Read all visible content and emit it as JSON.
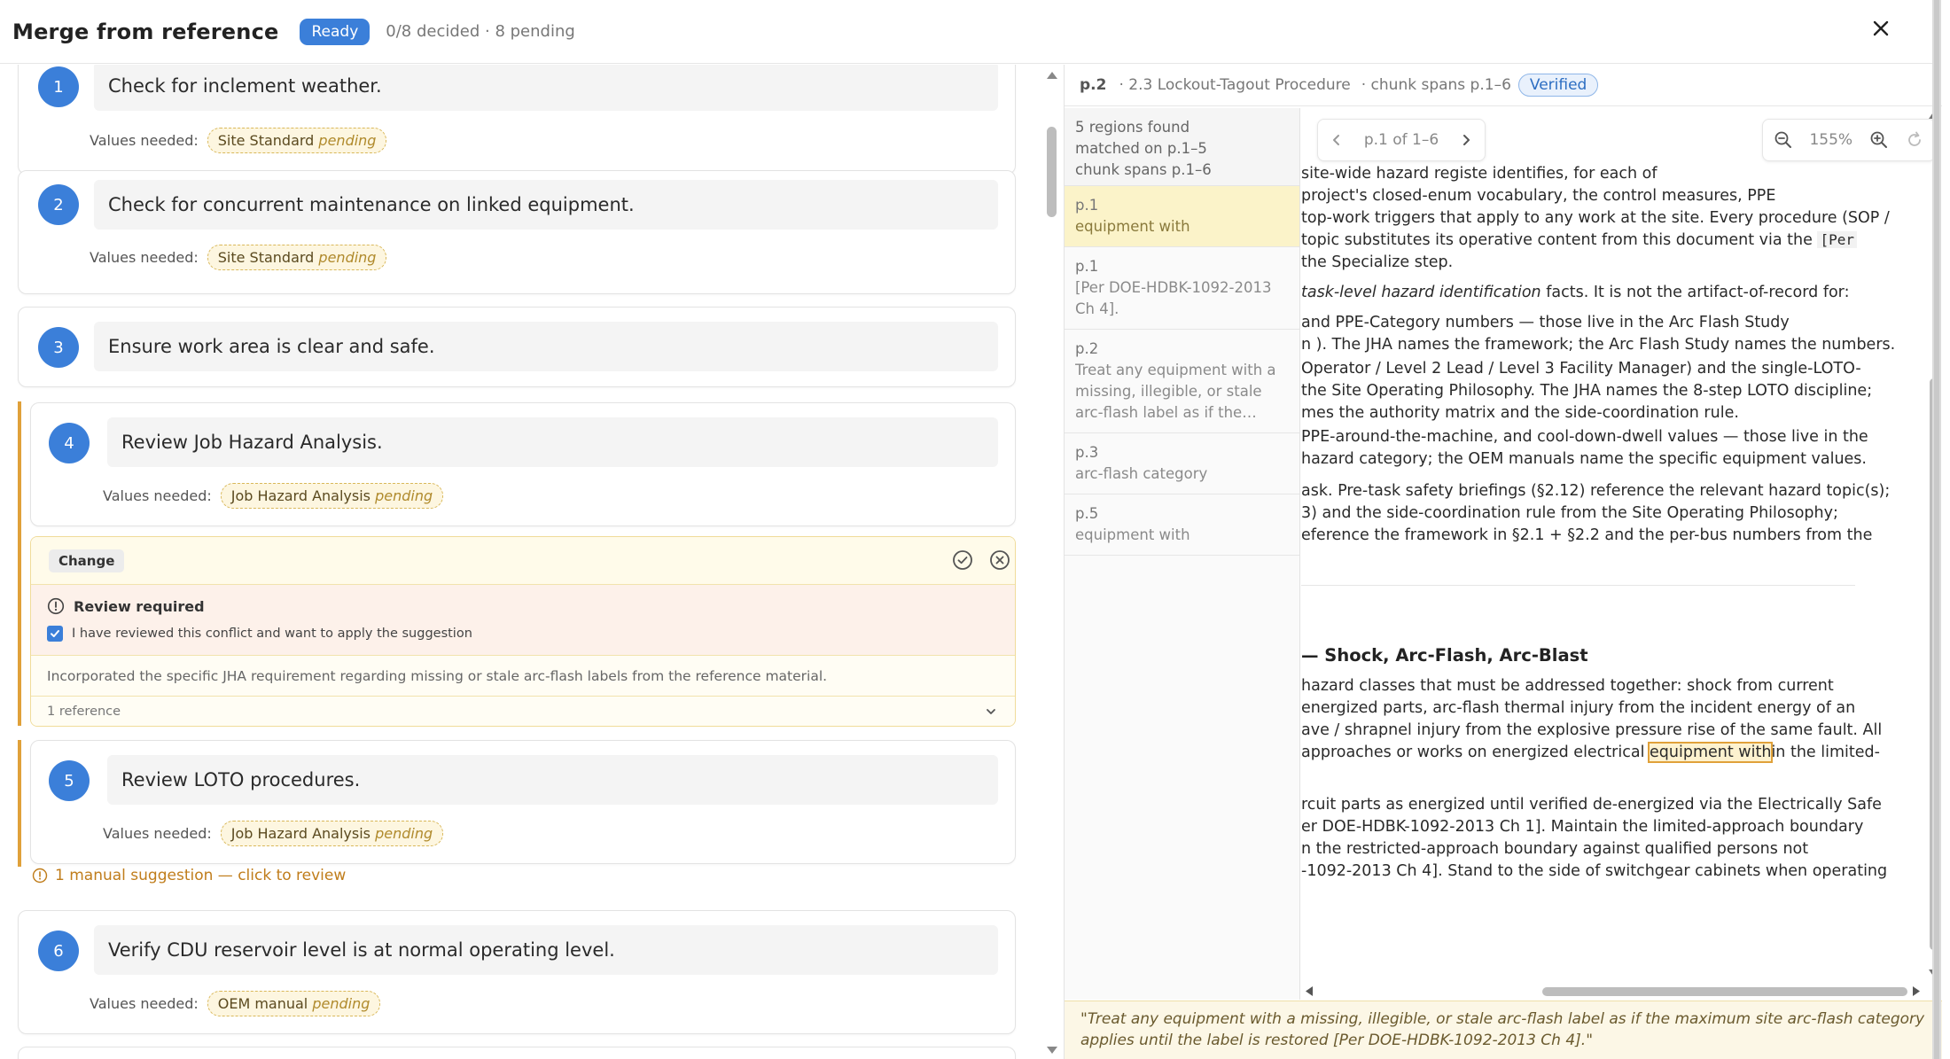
{
  "header": {
    "title": "Merge from reference",
    "status_badge": "Ready",
    "progress_text": "0/8 decided · 8 pending"
  },
  "steps": [
    {
      "num": "1",
      "text": "Check for inclement weather.",
      "values_label": "Values needed:",
      "chip_name": "Site Standard",
      "chip_status": "pending"
    },
    {
      "num": "2",
      "text": "Check for concurrent maintenance on linked equipment.",
      "values_label": "Values needed:",
      "chip_name": "Site Standard",
      "chip_status": "pending"
    },
    {
      "num": "3",
      "text": "Ensure work area is clear and safe."
    },
    {
      "num": "4",
      "text": "Review Job Hazard Analysis.",
      "values_label": "Values needed:",
      "chip_name": "Job Hazard Analysis",
      "chip_status": "pending"
    },
    {
      "num": "5",
      "text": "Review LOTO procedures.",
      "values_label": "Values needed:",
      "chip_name": "Job Hazard Analysis",
      "chip_status": "pending"
    },
    {
      "num": "6",
      "text": "Verify CDU reservoir level is at normal operating level.",
      "values_label": "Values needed:",
      "chip_name": "OEM manual",
      "chip_status": "pending"
    }
  ],
  "change": {
    "tag": "Change",
    "review_title": "Review required",
    "review_checkbox_label": "I have reviewed this conflict and want to apply the suggestion",
    "review_checked": true,
    "description": "Incorporated the specific JHA requirement regarding missing or stale arc-flash labels from the reference material.",
    "reference_count": "1 reference"
  },
  "manual_suggestion": "1 manual suggestion — click to review",
  "reference": {
    "page": "p.2",
    "section": "· 2.3 Lockout-Tagout Procedure",
    "chunk": "· chunk spans p.1–6",
    "verified": "Verified",
    "summary": [
      "5 regions found",
      "matched on p.1–5",
      "chunk spans p.1–6"
    ],
    "regions": [
      {
        "page": "p.1",
        "text": "equipment with",
        "active": true
      },
      {
        "page": "p.1",
        "text": "[Per DOE-HDBK-1092-2013 Ch 4]."
      },
      {
        "page": "p.2",
        "text": "Treat any equipment with a missing, illegible, or stale arc-flash label as if the maximum site arc-flash category applies"
      },
      {
        "page": "p.3",
        "text": "arc-flash category"
      },
      {
        "page": "p.5",
        "text": "equipment with"
      }
    ],
    "pager": "p.1 of 1–6",
    "zoom": "155%",
    "doc_lines": [
      "site-wide hazard registe                                  identifies, for each of",
      "project's closed-enum vocabulary, the control measures, PPE",
      "top-work triggers that apply to any work at the site. Every procedure (SOP /",
      "topic substitutes its operative content from this document via the",
      "the Specialize step.",
      "task-level hazard identification",
      "and PPE-Category numbers — those live in the Arc Flash Study",
      "n ). The JHA names the framework; the Arc Flash Study names the numbers.",
      "Operator / Level 2 Lead / Level 3 Facility Manager) and the single-LOTO-",
      "the Site Operating Philosophy. The JHA names the 8-step LOTO discipline;",
      "mes the authority matrix and the side-coordination rule.",
      "PPE-around-the-machine, and cool-down-dwell values — those live in the",
      "hazard category; the OEM manuals name the specific equipment values.",
      "ask. Pre-task safety briefings (§2.12) reference the relevant hazard topic(s);",
      "3) and the side-coordination rule from the Site Operating Philosophy;",
      "eference the framework in §2.1 + §2.2 and the per-bus numbers from the"
    ],
    "doc_line4_code": "[Per",
    "doc_line6_rest": "facts. It is not the artifact-of-record for:",
    "doc_heading": "— Shock, Arc-Flash, Arc-Blast",
    "doc_lines_b": [
      "hazard classes that must be addressed together: shock from current",
      "energized parts, arc-flash thermal injury from the incident energy of an",
      "ave / shrapnel injury from the explosive pressure rise of the same fault. All",
      "approaches or works on energized electrical"
    ],
    "doc_hl": "equipment with",
    "doc_hl_after": "in the limited-",
    "doc_lines_c": [
      "rcuit parts as energized until verified de-energized via the Electrically Safe",
      "er DOE-HDBK-1092-2013 Ch 1]. Maintain the limited-approach boundary",
      "n the restricted-approach boundary against qualified persons not",
      "-1092-2013 Ch 4]. Stand to the side of switchgear cabinets when operating"
    ],
    "quote": "\"Treat any equipment with a missing, illegible, or stale arc-flash label as if the maximum site arc-flash category applies until the label is restored [Per DOE-HDBK-1092-2013 Ch 4].\""
  },
  "colors": {
    "accent": "#3b7fd9",
    "warning": "#e0a13a",
    "chip_bg": "#fdf6e0",
    "highlight_bg": "#fbf3c9"
  }
}
